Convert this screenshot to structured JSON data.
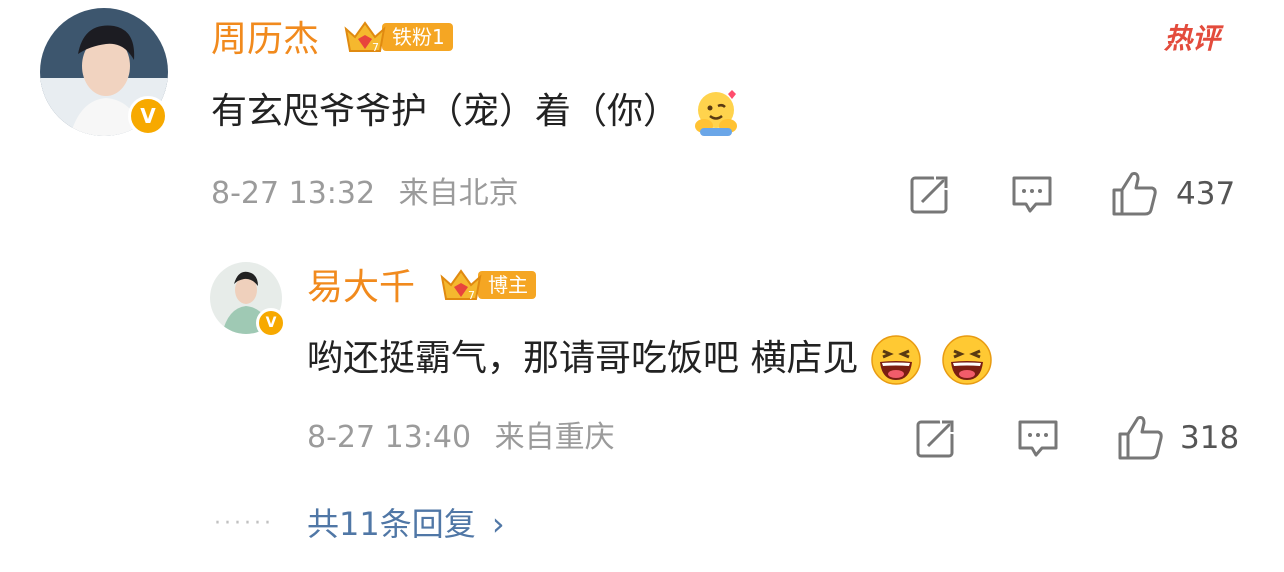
{
  "hot_label": "热评",
  "comment": {
    "username": "周历杰",
    "fan_badge": "铁粉1",
    "text": "有玄咫爷爷护（宠）着（你）",
    "time": "8-27 13:32",
    "location": "来自北京",
    "likes": "437"
  },
  "reply": {
    "username": "易大千",
    "fan_badge": "博主",
    "text": "哟还挺霸气，那请哥吃饭吧 横店见",
    "time": "8-27 13:40",
    "location": "来自重庆",
    "likes": "318"
  },
  "more_replies": "共11条回复",
  "colors": {
    "username": "#f18a1d",
    "badge": "#f5a623",
    "link": "#5077a6",
    "meta": "#9b9b9b",
    "hot": "#e34b3c"
  },
  "icons": [
    "repost-icon",
    "comment-icon",
    "like-icon",
    "verified-icon",
    "crown-icon",
    "emoji-hug-icon",
    "emoji-laugh-icon"
  ]
}
